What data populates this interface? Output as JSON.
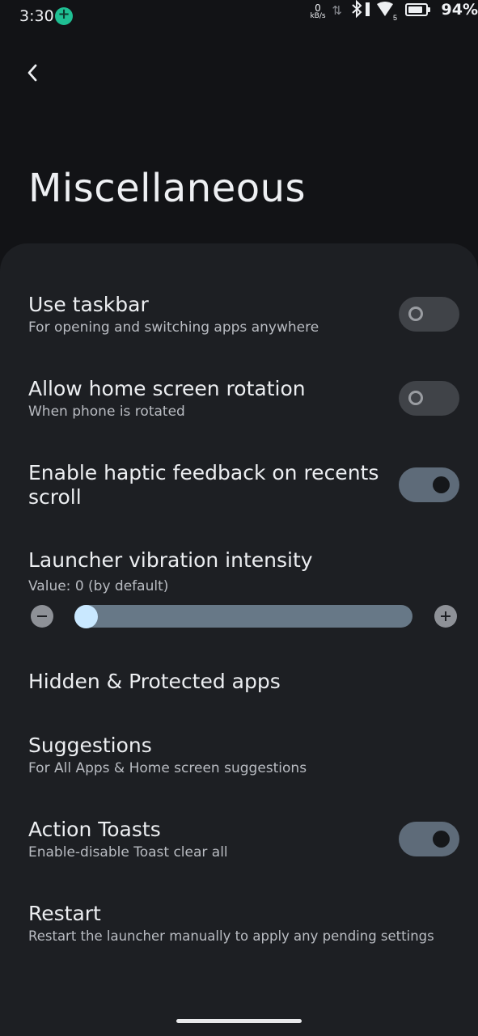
{
  "status_bar": {
    "time": "3:30",
    "net_speed_value": "0",
    "net_speed_unit": "kB/s",
    "sim_label": "5",
    "battery_percent": "94%"
  },
  "header": {
    "back_icon": "chevron-left-icon",
    "title": "Miscellaneous"
  },
  "settings": {
    "use_taskbar": {
      "title": "Use taskbar",
      "subtitle": "For opening and switching apps anywhere",
      "enabled": false
    },
    "home_rotation": {
      "title": "Allow home screen rotation",
      "subtitle": "When phone is rotated",
      "enabled": false
    },
    "haptic_recents": {
      "title": "Enable haptic feedback on recents scroll",
      "enabled": true
    },
    "vibration": {
      "title": "Launcher vibration intensity",
      "value_text": "Value: 0 (by default)",
      "value": 0,
      "fraction": 0.0
    },
    "hidden_apps": {
      "title": "Hidden & Protected apps"
    },
    "suggestions": {
      "title": "Suggestions",
      "subtitle": "For All Apps & Home screen suggestions"
    },
    "action_toasts": {
      "title": "Action Toasts",
      "subtitle": "Enable-disable Toast clear all",
      "enabled": true
    },
    "restart": {
      "title": "Restart",
      "subtitle": "Restart the launcher manually to apply any pending settings"
    }
  },
  "colors": {
    "background": "#121316",
    "card": "#1d1f23",
    "toggle_on": "#5e6b79",
    "toggle_off": "#404348",
    "slider_track": "#677887",
    "slider_thumb": "#c9e8ff"
  }
}
